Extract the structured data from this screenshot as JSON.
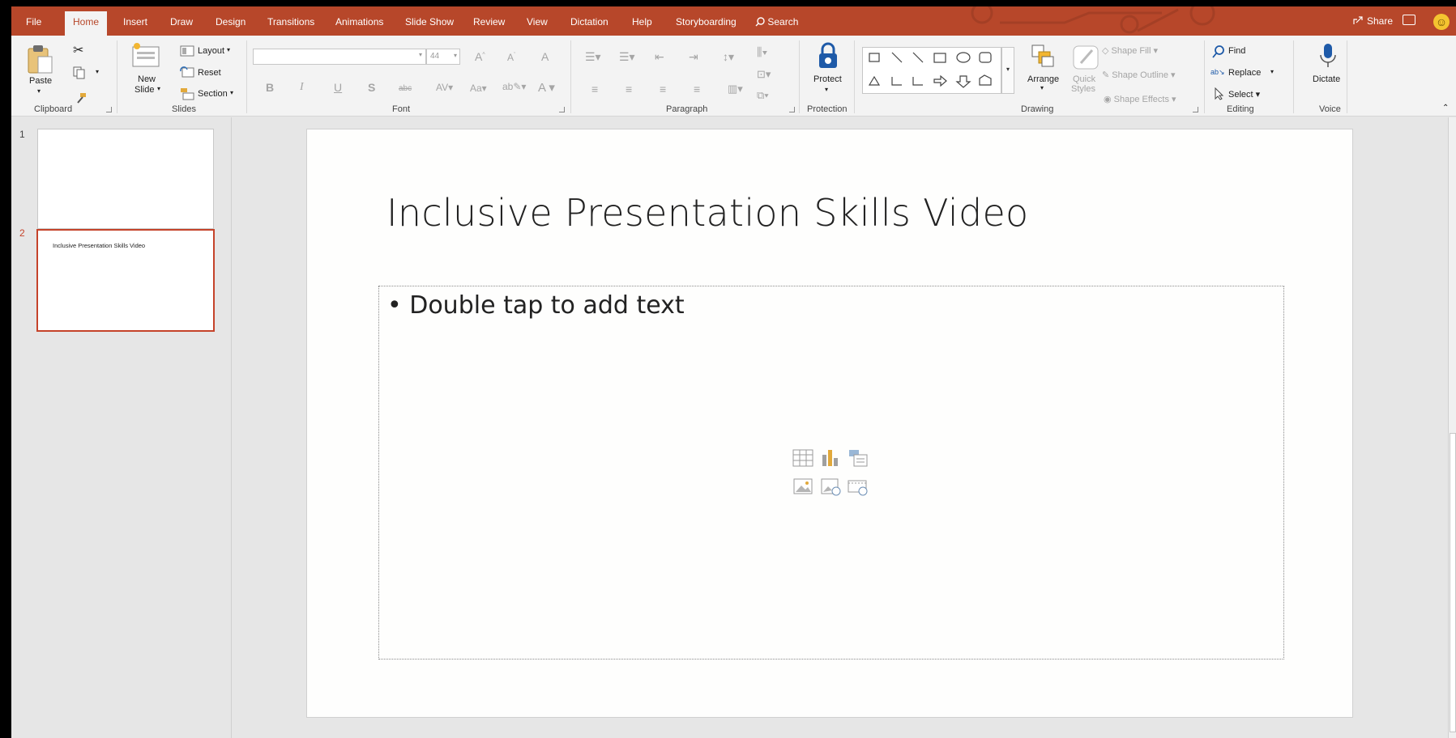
{
  "colors": {
    "accent": "#b7472a",
    "ribbon_bg": "#f3f3f3",
    "selected_border": "#c5432a"
  },
  "tabs": [
    "File",
    "Home",
    "Insert",
    "Draw",
    "Design",
    "Transitions",
    "Animations",
    "Slide Show",
    "Review",
    "View",
    "Dictation",
    "Help",
    "Storyboarding",
    "Search"
  ],
  "active_tab": "Home",
  "titlebar": {
    "share_label": "Share",
    "search_icon": "search-icon",
    "comment_icon": "comment-icon",
    "smiley_icon": "smiley-icon"
  },
  "ribbon": {
    "clipboard": {
      "paste": "Paste",
      "label": "Clipboard"
    },
    "slides": {
      "new_slide_1": "New",
      "new_slide_2": "Slide",
      "layout": "Layout",
      "reset": "Reset",
      "section": "Section",
      "label": "Slides"
    },
    "font": {
      "font_name": "",
      "font_size": "44",
      "label": "Font"
    },
    "paragraph": {
      "label": "Paragraph"
    },
    "protection": {
      "protect": "Protect",
      "label": "Protection"
    },
    "drawing": {
      "arrange": "Arrange",
      "quick_styles_1": "Quick",
      "quick_styles_2": "Styles",
      "shape_fill": "Shape Fill",
      "shape_outline": "Shape Outline",
      "shape_effects": "Shape Effects",
      "label": "Drawing"
    },
    "editing": {
      "find": "Find",
      "replace": "Replace",
      "select": "Select",
      "label": "Editing"
    },
    "voice": {
      "dictate": "Dictate",
      "label": "Voice"
    }
  },
  "slides": [
    {
      "number": "1",
      "title": ""
    },
    {
      "number": "2",
      "title": "Inclusive Presentation Skills Video"
    }
  ],
  "current_slide": {
    "title": "Inclusive Presentation Skills Video",
    "placeholder_text": "• Double tap to add text"
  }
}
